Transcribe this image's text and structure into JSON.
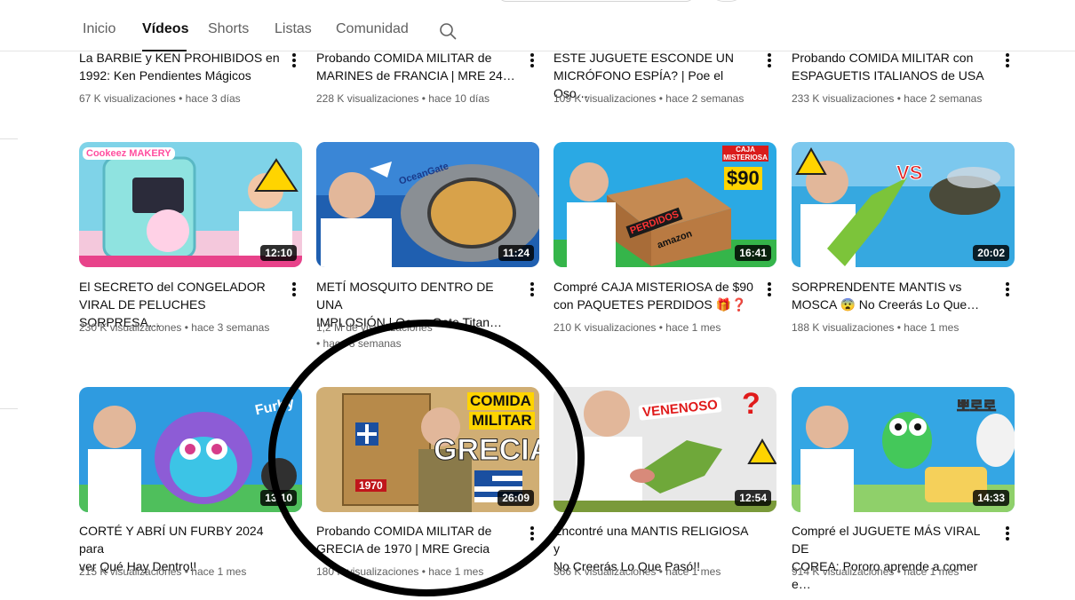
{
  "tabs": [
    "Inicio",
    "Vídeos",
    "Shorts",
    "Listas",
    "Comunidad"
  ],
  "active_tab": "Vídeos",
  "icons": {
    "search": "search-icon",
    "more": "more-vert-icon"
  },
  "colors": {
    "annotation_circle": "#000000",
    "meta_text": "#606060",
    "title_text": "#0f0f0f"
  },
  "row0": [
    {
      "title": "La BARBIE y KEN PROHIBIDOS en\n1992: Ken Pendientes Mágicos",
      "views": "67 K visualizaciones",
      "age": "hace 3 días"
    },
    {
      "title": "Probando COMIDA MILITAR de\nMARINES de FRANCIA | MRE 24…",
      "views": "228 K visualizaciones",
      "age": "hace 10 días"
    },
    {
      "title": "ESTE JUGUETE ESCONDE UN\nMICRÓFONO ESPÍA? | Poe el Oso…",
      "views": "109 K visualizaciones",
      "age": "hace 2 semanas"
    },
    {
      "title": "Probando COMIDA MILITAR con\nESPAGUETIS ITALIANOS de USA",
      "views": "233 K visualizaciones",
      "age": "hace 2 semanas"
    }
  ],
  "row1": [
    {
      "title": "El SECRETO del CONGELADOR\nVIRAL DE PELUCHES SORPRESA…",
      "views": "230 K visualizaciones",
      "age": "hace 3 semanas",
      "duration": "12:10",
      "thumb_text": "Cookeez MAKERY"
    },
    {
      "title": "METÍ MOSQUITO DENTRO DE UNA\nIMPLOSIÓN | OceanGate Titan…",
      "views": "1,2 M de visualizaciones",
      "age": "hace 3 semanas",
      "duration": "11:24",
      "thumb_text": "OceanGate"
    },
    {
      "title": "Compré CAJA MISTERIOSA de $90\ncon PAQUETES PERDIDOS 🎁❓",
      "views": "210 K visualizaciones",
      "age": "hace 1 mes",
      "duration": "16:41",
      "thumb_text": [
        "CAJA MISTERIOSA",
        "$90",
        "PERDIDOS",
        "amazon"
      ]
    },
    {
      "title": "SORPRENDENTE MANTIS vs\nMOSCA 😨 No Creerás Lo Que…",
      "views": "188 K visualizaciones",
      "age": "hace 1 mes",
      "duration": "20:02",
      "thumb_text": "VS"
    }
  ],
  "row2": [
    {
      "title": "CORTÉ Y ABRÍ UN FURBY 2024 para\nver Qué Hay Dentro!!",
      "views": "215 K visualizaciones",
      "age": "hace 1 mes",
      "duration": "13:10",
      "thumb_text": "Furby"
    },
    {
      "title": "Probando COMIDA MILITAR de\nGRECIA de 1970 | MRE Grecia",
      "views": "180 K visualizaciones",
      "age": "hace 1 mes",
      "duration": "26:09",
      "thumb_text": [
        "COMIDA",
        "MILITAR",
        "GRECIA",
        "1970"
      ]
    },
    {
      "title": "Encontré una MANTIS RELIGIOSA y\nNo Creerás Lo Que Pasó!!",
      "views": "366 K visualizaciones",
      "age": "hace 1 mes",
      "duration": "12:54",
      "thumb_text": "VENENOSO"
    },
    {
      "title": "Compré el JUGUETE MÁS VIRAL DE\nCOREA: Pororo aprende a comer e…",
      "views": "914 K visualizaciones",
      "age": "hace 1 mes",
      "duration": "14:33",
      "thumb_text": "뽀로로"
    }
  ]
}
